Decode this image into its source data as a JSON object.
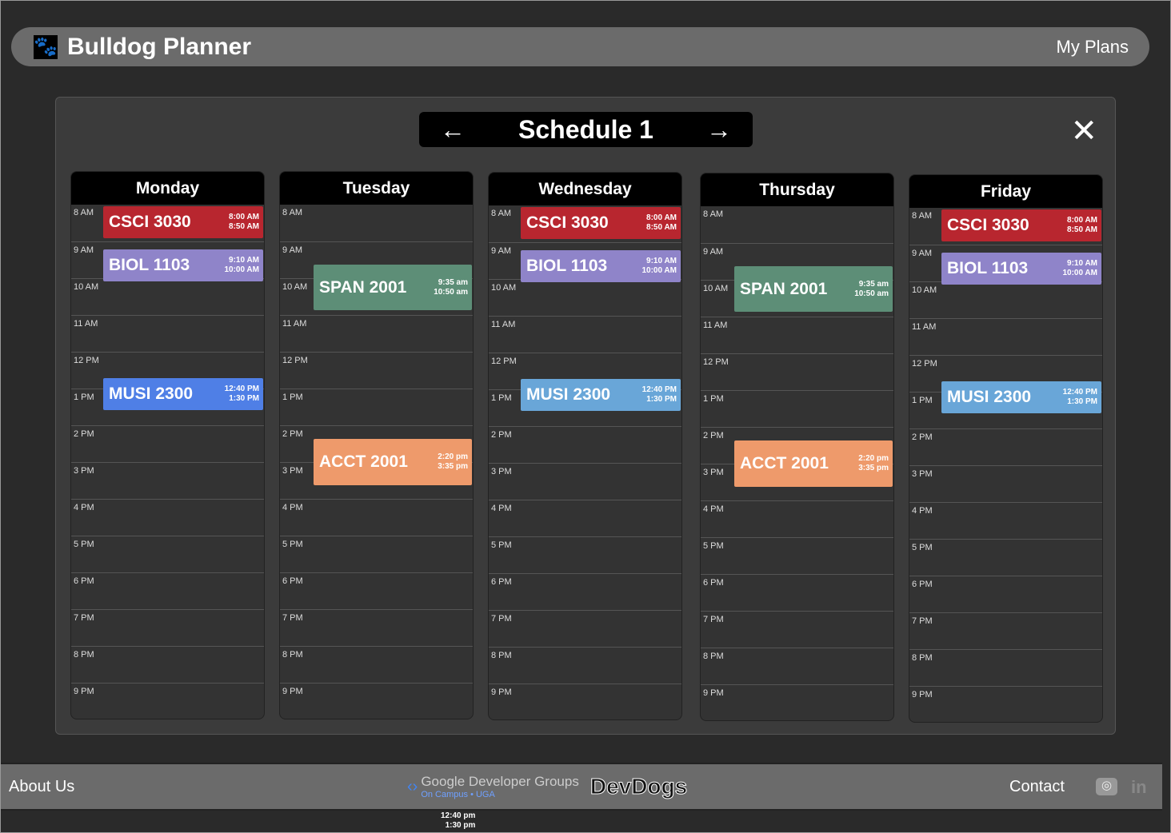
{
  "header": {
    "title": "Bulldog Planner",
    "my_plans": "My Plans",
    "logo_icon": "paw-icon"
  },
  "schedule": {
    "name": "Schedule 1",
    "prev_icon": "arrow-left-icon",
    "next_icon": "arrow-right-icon",
    "close_icon": "close-icon"
  },
  "hours": [
    "8 AM",
    "9 AM",
    "10 AM",
    "11 AM",
    "12 PM",
    "1 PM",
    "2 PM",
    "3 PM",
    "4 PM",
    "5 PM",
    "6 PM",
    "7 PM",
    "8 PM",
    "9 PM"
  ],
  "colors": {
    "CSCI": "#b8262f",
    "BIOL": "#8f84c9",
    "MUSI_mon": "#4f7fe6",
    "MUSI": "#69a6d8",
    "SPAN": "#5d8e77",
    "ACCT": "#ee9a6b"
  },
  "days": [
    {
      "name": "Monday",
      "events": [
        {
          "code": "CSCI 3030",
          "start": "8:00 AM",
          "end": "8:50 AM",
          "color": "#b8262f"
        },
        {
          "code": "BIOL 1103",
          "start": "9:10 AM",
          "end": "10:00 AM",
          "color": "#8f84c9"
        },
        {
          "code": "MUSI 2300",
          "start": "12:40 PM",
          "end": "1:30 PM",
          "color": "#4f7fe6"
        }
      ]
    },
    {
      "name": "Tuesday",
      "events": [
        {
          "code": "SPAN 2001",
          "start": "9:35 am",
          "end": "10:50 am",
          "color": "#5d8e77"
        },
        {
          "code": "ACCT 2001",
          "start": "2:20 pm",
          "end": "3:35 pm",
          "color": "#ee9a6b"
        }
      ]
    },
    {
      "name": "Wednesday",
      "events": [
        {
          "code": "CSCI 3030",
          "start": "8:00 AM",
          "end": "8:50 AM",
          "color": "#b8262f"
        },
        {
          "code": "BIOL 1103",
          "start": "9:10 AM",
          "end": "10:00 AM",
          "color": "#8f84c9"
        },
        {
          "code": "MUSI 2300",
          "start": "12:40 PM",
          "end": "1:30 PM",
          "color": "#69a6d8"
        }
      ]
    },
    {
      "name": "Thursday",
      "events": [
        {
          "code": "SPAN 2001",
          "start": "9:35 am",
          "end": "10:50 am",
          "color": "#5d8e77"
        },
        {
          "code": "ACCT 2001",
          "start": "2:20 pm",
          "end": "3:35 pm",
          "color": "#ee9a6b"
        }
      ]
    },
    {
      "name": "Friday",
      "events": [
        {
          "code": "CSCI 3030",
          "start": "8:00 AM",
          "end": "8:50 AM",
          "color": "#b8262f"
        },
        {
          "code": "BIOL 1103",
          "start": "9:10 AM",
          "end": "10:00 AM",
          "color": "#8f84c9"
        },
        {
          "code": "MUSI 2300",
          "start": "12:40 PM",
          "end": "1:30 PM",
          "color": "#69a6d8"
        }
      ]
    }
  ],
  "footer": {
    "about": "About Us",
    "gdg": "Google Developer Groups",
    "gdg_sub": "On Campus • UGA",
    "devdogs": "DevDogs",
    "contact": "Contact",
    "instagram_icon": "instagram-icon",
    "linkedin_icon": "linkedin-icon"
  },
  "stray_times": {
    "start": "12:40 pm",
    "end": "1:30 pm"
  }
}
